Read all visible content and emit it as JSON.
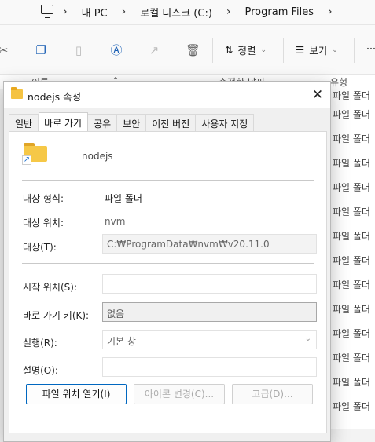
{
  "explorer": {
    "breadcrumbs": [
      "내 PC",
      "로컬 디스크 (C:)",
      "Program Files"
    ],
    "toolbar": {
      "sort_label": "정렬",
      "view_label": "보기",
      "more_label": "···"
    },
    "columns": {
      "name": "이름",
      "modified": "수정한 날짜",
      "type": "유형"
    },
    "file_types": [
      "파일 폴더",
      "파일 폴더",
      "파일 폴더",
      "파일 폴더",
      "파일 폴더",
      "파일 폴더",
      "파일 폴더",
      "파일 폴더",
      "파일 폴더",
      "파일 폴더",
      "파일 폴더",
      "파일 폴더",
      "파일 폴더",
      "파일 폴더"
    ]
  },
  "dialog": {
    "title": "nodejs 속성",
    "tabs": [
      "일반",
      "바로 가기",
      "공유",
      "보안",
      "이전 버전",
      "사용자 지정"
    ],
    "active_tab": "바로 가기",
    "shortcut_name": "nodejs",
    "target_type_label": "대상 형식:",
    "target_type_value": "파일 폴더",
    "target_location_label": "대상 위치:",
    "target_location_value": "nvm",
    "target_label": "대상(T):",
    "target_value": "C:₩ProgramData₩nvm₩v20.11.0",
    "start_in_label": "시작 위치(S):",
    "start_in_value": "",
    "hotkey_label": "바로 가기 키(K):",
    "hotkey_value": "없음",
    "run_label": "실행(R):",
    "run_value": "기본 창",
    "comment_label": "설명(O):",
    "comment_value": "",
    "buttons": {
      "open_location": "파일 위치 열기(I)",
      "change_icon": "아이콘 변경(C)...",
      "advanced": "고급(D)..."
    }
  }
}
